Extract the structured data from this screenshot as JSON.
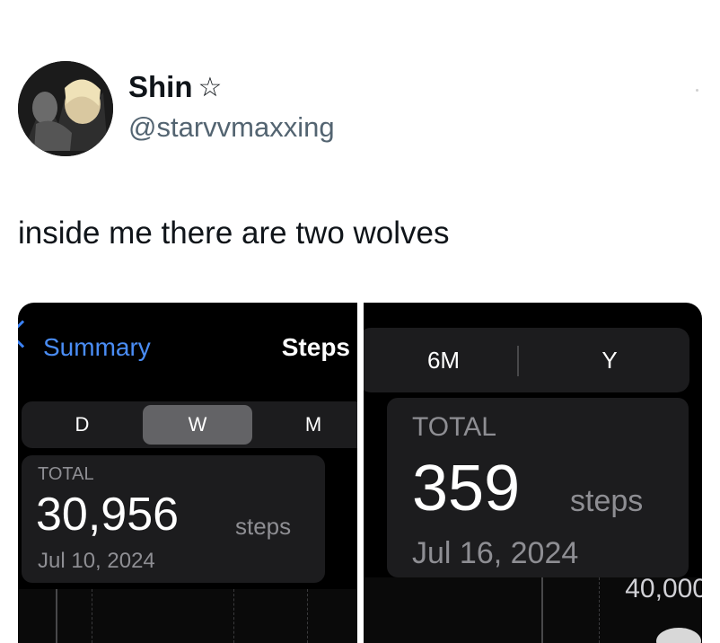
{
  "tweet": {
    "display_name": "Shin",
    "handle": "@starvvmaxxing",
    "text": "inside me there are two wolves"
  },
  "screenshot_left": {
    "back_label": "Summary",
    "title": "Steps",
    "segments": [
      "D",
      "W",
      "M"
    ],
    "selected_segment": "W",
    "total_label": "TOTAL",
    "total_value": "30,956",
    "unit": "steps",
    "date": "Jul 10, 2024"
  },
  "screenshot_right": {
    "segments": [
      "6M",
      "Y"
    ],
    "total_label": "TOTAL",
    "total_value": "359",
    "unit": "steps",
    "date": "Jul 16, 2024",
    "axis_label": "40,000"
  },
  "colors": {
    "link_blue": "#4a8df5",
    "dark_bg": "#000000",
    "card_bg": "#1c1c1e",
    "secondary_text": "#8e8e93"
  }
}
